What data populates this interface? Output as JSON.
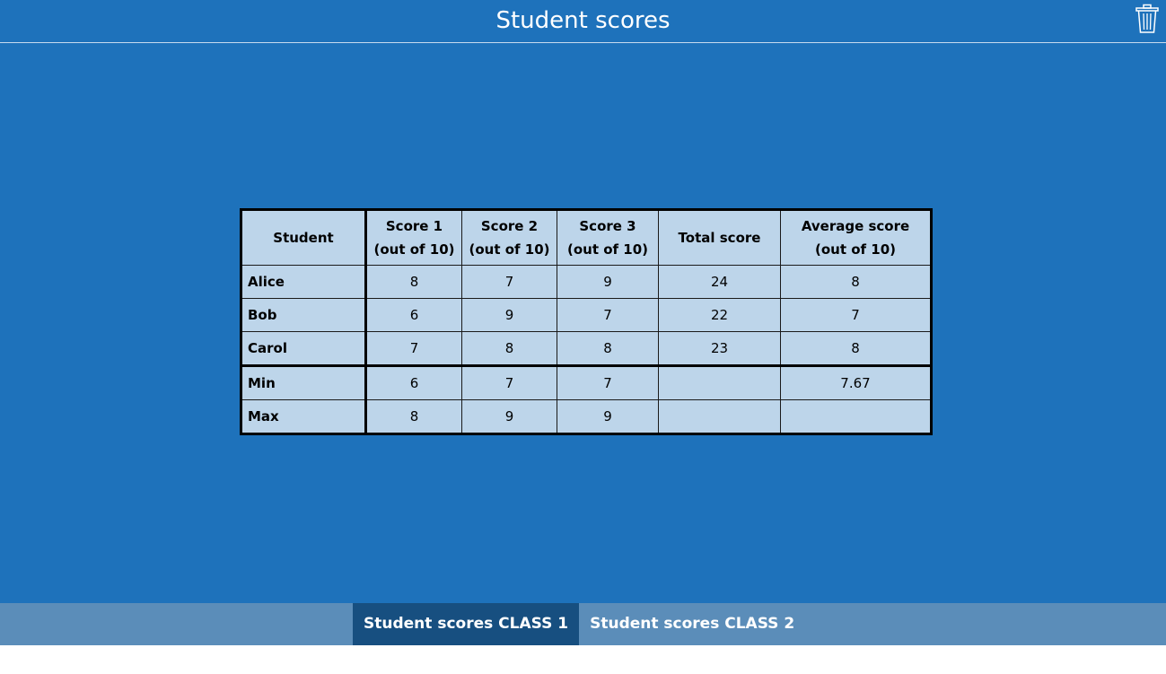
{
  "header": {
    "title": "Student scores",
    "trash_icon": "trash-icon"
  },
  "table": {
    "headers": [
      {
        "line1": "Student",
        "line2": ""
      },
      {
        "line1": "Score 1",
        "line2": "(out of 10)"
      },
      {
        "line1": "Score 2",
        "line2": "(out of 10)"
      },
      {
        "line1": "Score 3",
        "line2": "(out of 10)"
      },
      {
        "line1": "Total score",
        "line2": ""
      },
      {
        "line1": "Average score",
        "line2": "(out of 10)"
      }
    ],
    "rows": [
      {
        "label": "Alice",
        "cells": [
          "8",
          "7",
          "9",
          "24",
          "8"
        ]
      },
      {
        "label": "Bob",
        "cells": [
          "6",
          "9",
          "7",
          "22",
          "7"
        ]
      },
      {
        "label": "Carol",
        "cells": [
          "7",
          "8",
          "8",
          "23",
          "8"
        ]
      }
    ],
    "stats": [
      {
        "label": "Min",
        "cells": [
          "6",
          "7",
          "7",
          "",
          "7.67"
        ]
      },
      {
        "label": "Max",
        "cells": [
          "8",
          "9",
          "9",
          "",
          ""
        ]
      }
    ]
  },
  "tabs": [
    {
      "label": "Student scores CLASS 1",
      "active": true
    },
    {
      "label": "Student scores CLASS 2",
      "active": false
    }
  ],
  "colors": {
    "background": "#1e72bb",
    "table_fill": "#bdd5ea",
    "tabbar": "#5b8db9",
    "active_tab": "#174f80"
  }
}
